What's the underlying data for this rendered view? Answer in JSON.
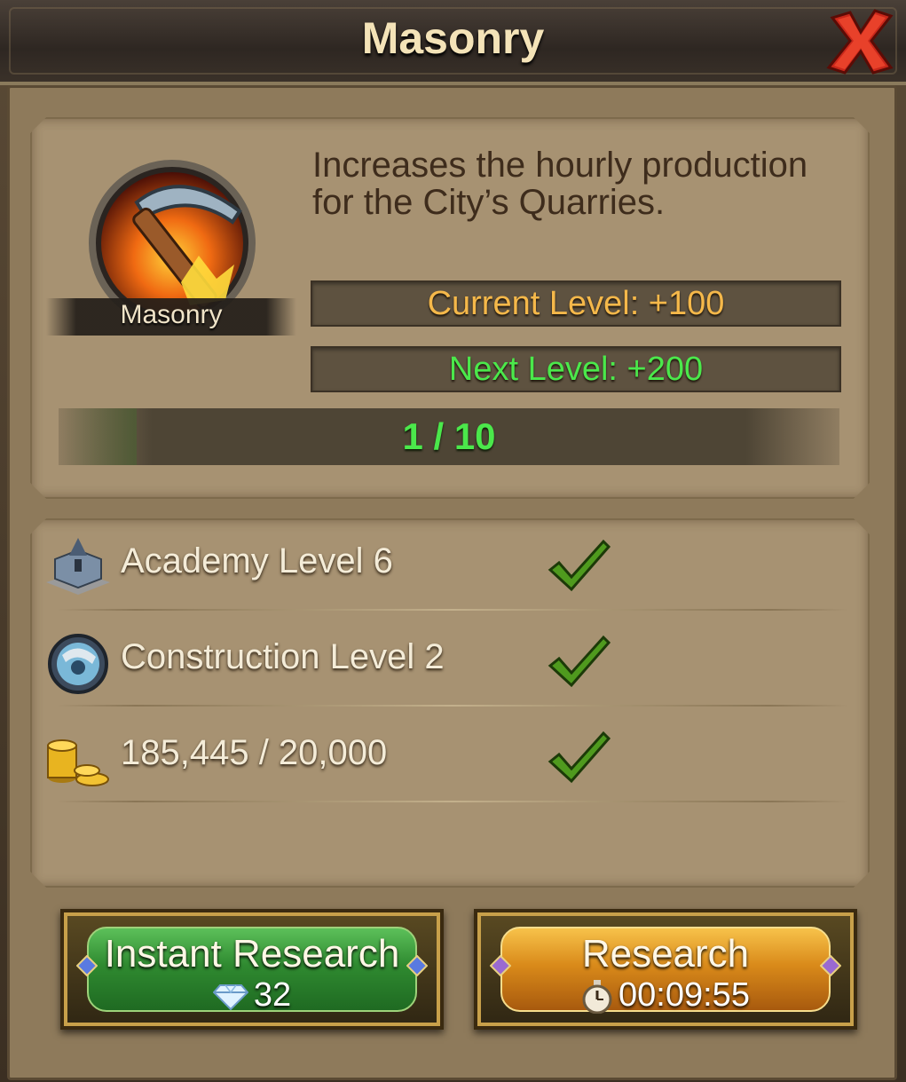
{
  "dialog": {
    "title": "Masonry"
  },
  "tech": {
    "name": "Masonry",
    "icon": "pickaxe-icon",
    "description": "Increases the hourly production for the City’s Quarries.",
    "current_level": "Current Level: +100",
    "next_level": "Next Level: +200",
    "progress_text": "1 / 10",
    "progress_fraction": 0.1
  },
  "requirements": [
    {
      "icon": "academy-building-icon",
      "text": "Academy Level 6",
      "met": true
    },
    {
      "icon": "construction-tech-icon",
      "text": "Construction Level 2",
      "met": true
    },
    {
      "icon": "gold-coins-icon",
      "text": "185,445 / 20,000",
      "met": true
    }
  ],
  "buttons": {
    "instant": {
      "label": "Instant Research",
      "cost": "32",
      "cost_icon": "diamond-icon"
    },
    "research": {
      "label": "Research",
      "time": "00:09:55",
      "time_icon": "stopwatch-icon"
    }
  },
  "colors": {
    "current_level": "#f5b84a",
    "next_level": "#4be84b",
    "progress_text": "#4be84b",
    "instant_button": "#2f8a30",
    "research_button": "#d98a1a",
    "close_x": "#d8301c"
  }
}
